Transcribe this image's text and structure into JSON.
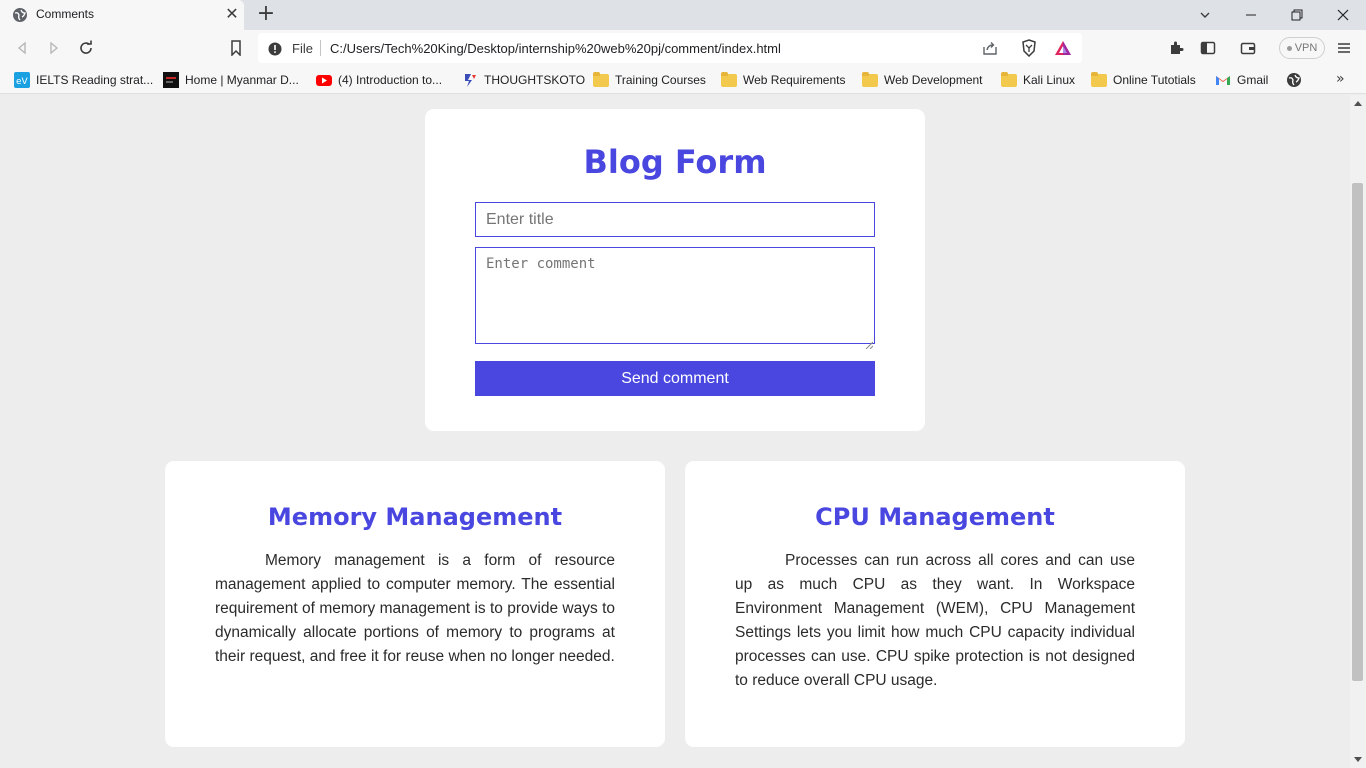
{
  "browser": {
    "tab": {
      "title": "Comments",
      "close": "✕"
    },
    "new_tab": "+",
    "omnibox": {
      "scheme": "File",
      "url": "C:/Users/Tech%20King/Desktop/internship%20web%20pj/comment/index.html"
    },
    "vpn_label": "VPN"
  },
  "bookmarks": [
    {
      "label": "IELTS Reading strat...",
      "icon": "ev-icon"
    },
    {
      "label": "Home | Myanmar D...",
      "icon": "site-icon"
    },
    {
      "label": "(4) Introduction to...",
      "icon": "youtube-icon"
    },
    {
      "label": "THOUGHTSKOTO",
      "icon": "thoughtskoto-icon"
    },
    {
      "label": "Training Courses",
      "icon": "folder-icon"
    },
    {
      "label": "Web Requirements",
      "icon": "folder-icon"
    },
    {
      "label": "Web Development",
      "icon": "folder-icon"
    },
    {
      "label": "Kali Linux",
      "icon": "folder-icon"
    },
    {
      "label": "Online Tutotials",
      "icon": "folder-icon"
    },
    {
      "label": "Gmail",
      "icon": "gmail-icon"
    }
  ],
  "form": {
    "title": "Blog Form",
    "title_placeholder": "Enter title",
    "comment_placeholder": "Enter comment",
    "submit_label": "Send comment"
  },
  "cards": [
    {
      "title": "Memory Management",
      "text": "Memory management is a form of resource management applied to computer memory. The essential requirement of memory management is to provide ways to dynamically allocate portions of memory to programs at their request, and free it for reuse when no longer needed."
    },
    {
      "title": "CPU Management",
      "text": "Processes can run across all cores and can use up as much CPU as they want. In Workspace Environment Management (WEM), CPU Management Settings lets you limit how much CPU capacity individual processes can use. CPU spike protection is not designed to reduce overall CPU usage."
    }
  ],
  "colors": {
    "accent": "#4a47e0",
    "page_bg": "#ededed",
    "card_bg": "#ffffff"
  }
}
